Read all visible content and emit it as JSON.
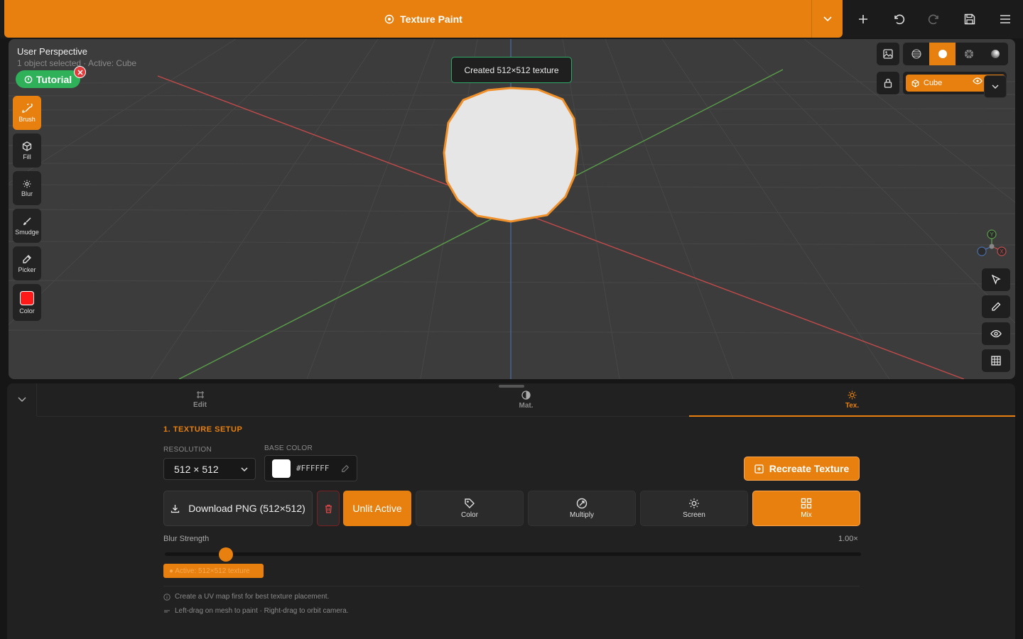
{
  "header": {
    "mode_title": "Texture Paint",
    "accent": "#e8800f"
  },
  "viewport": {
    "title": "User Perspective",
    "subtitle": "1 object selected · Active: Cube",
    "tutorial_label": "Tutorial",
    "toast": "Created 512×512 texture",
    "object_name": "Cube",
    "gizmo": {
      "y": "Y",
      "x": "X"
    }
  },
  "tools": [
    {
      "label": "Brush",
      "icon": "brush-icon",
      "active": true
    },
    {
      "label": "Fill",
      "icon": "cube-icon"
    },
    {
      "label": "Blur",
      "icon": "blur-icon"
    },
    {
      "label": "Smudge",
      "icon": "smudge-icon"
    },
    {
      "label": "Picker",
      "icon": "eyedropper-icon"
    },
    {
      "label": "Color",
      "icon": "color-swatch",
      "color": "#ff1a1a"
    }
  ],
  "tabs": [
    {
      "label": "Edit",
      "icon": "edit-icon"
    },
    {
      "label": "Mat.",
      "icon": "material-icon"
    },
    {
      "label": "Tex.",
      "icon": "texture-icon",
      "active": true
    }
  ],
  "texture_setup": {
    "section_title": "1. TEXTURE SETUP",
    "resolution_label": "RESOLUTION",
    "resolution_value": "512 × 512",
    "base_color_label": "BASE COLOR",
    "base_color_hex": "#FFFFFF",
    "recreate_label": "Recreate Texture",
    "download_label": "Download PNG (512×512)",
    "unlit_label": "Unlit Active",
    "blend_modes": [
      {
        "label": "Color",
        "icon": "tag-icon"
      },
      {
        "label": "Multiply",
        "icon": "multiply-icon"
      },
      {
        "label": "Screen",
        "icon": "sun-icon"
      },
      {
        "label": "Mix",
        "icon": "grid-icon",
        "active": true
      }
    ],
    "blur_label": "Blur Strength",
    "blur_value": "1.00×",
    "blur_fraction": 0.088,
    "active_badge": "● Active: 512×512 texture",
    "hints": [
      "Create a UV map first for best texture placement.",
      "Left-drag on mesh to paint · Right-drag to orbit camera."
    ]
  }
}
